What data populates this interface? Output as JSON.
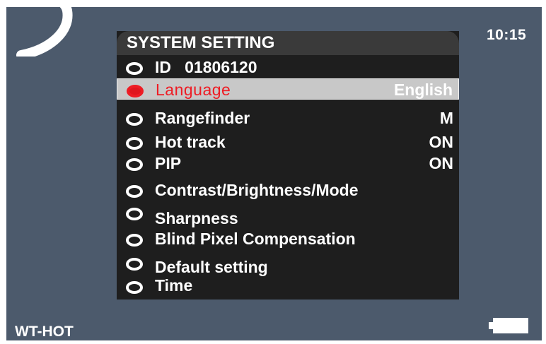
{
  "status": {
    "time": "10:15",
    "device_name": "WT-HOT"
  },
  "menu": {
    "title": "SYSTEM SETTING",
    "selected_index": 1,
    "items": [
      {
        "label": "ID   01806120",
        "value": ""
      },
      {
        "label": "Language",
        "value": "English"
      },
      {
        "label": "Rangefinder",
        "value": "M"
      },
      {
        "label": "Hot track",
        "value": "ON"
      },
      {
        "label": "PIP",
        "value": "ON"
      },
      {
        "label": "Contrast/Brightness/Mode",
        "value": ""
      },
      {
        "label": "Sharpness",
        "value": ""
      },
      {
        "label": "Blind Pixel Compensation",
        "value": ""
      },
      {
        "label": "Default setting",
        "value": ""
      },
      {
        "label": "Time",
        "value": ""
      }
    ]
  },
  "icons": {
    "bullet": "ring-bullet-icon",
    "battery": "battery-icon"
  },
  "colors": {
    "screen_background": "#4c5a6c",
    "menu_background": "#1e1e1e",
    "selected_row": "#c8c8c8",
    "selected_text": "#ee1c24",
    "text": "#ffffff"
  }
}
